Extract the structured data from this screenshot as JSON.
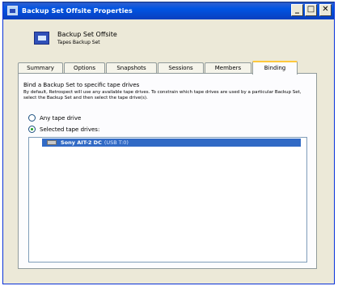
{
  "window": {
    "title": "Backup Set Offsite Properties",
    "buttons": {
      "minimize": "_",
      "maximize": "□",
      "close": "✕"
    }
  },
  "header": {
    "name": "Backup Set Offsite",
    "subtitle": "Tapes Backup Set"
  },
  "tabs": [
    {
      "label": "Summary",
      "active": false
    },
    {
      "label": "Options",
      "active": false
    },
    {
      "label": "Snapshots",
      "active": false
    },
    {
      "label": "Sessions",
      "active": false
    },
    {
      "label": "Members",
      "active": false
    },
    {
      "label": "Binding",
      "active": true
    }
  ],
  "binding": {
    "heading": "Bind a Backup Set to specific tape drives",
    "description": "By default, Retrospect will use any available tape drives. To constrain which tape drives are used by a particular Backup Set, select the Backup Set and then select the tape drive(s).",
    "option_any": "Any tape drive",
    "option_selected": "Selected tape drives:",
    "selected_option": "selected",
    "drives": [
      {
        "name": "Sony AIT-2 DC",
        "port": "(USB T:0)"
      }
    ]
  },
  "icons": {
    "title": "app-icon",
    "backup_set": "backup-set-icon",
    "drive": "tape-drive-icon"
  }
}
